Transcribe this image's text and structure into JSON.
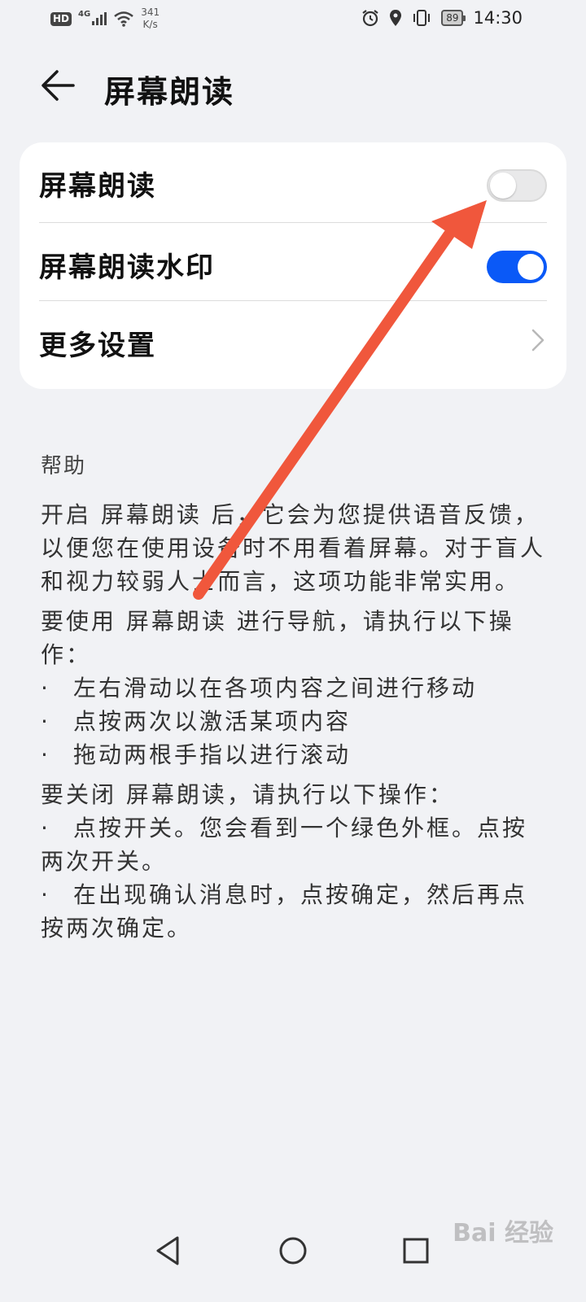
{
  "status_bar": {
    "hd": "HD",
    "network": "4G",
    "speed_value": "341",
    "speed_unit": "K/s",
    "battery": "89",
    "time": "14:30"
  },
  "header": {
    "title": "屏幕朗读"
  },
  "settings": {
    "items": [
      {
        "label": "屏幕朗读",
        "toggle": "off"
      },
      {
        "label": "屏幕朗读水印",
        "toggle": "on"
      },
      {
        "label": "更多设置"
      }
    ],
    "accent_color": "#0a59f7"
  },
  "help": {
    "title": "帮助",
    "paragraph1": "开启 屏幕朗读 后，它会为您提供语音反馈，以便您在使用设备时不用看着屏幕。对于盲人和视力较弱人士而言，这项功能非常实用。",
    "paragraph2": "要使用 屏幕朗读 进行导航，请执行以下操作：",
    "nav_bullets": [
      "左右滑动以在各项内容之间进行移动",
      "点按两次以激活某项内容",
      "拖动两根手指以进行滚动"
    ],
    "paragraph3": "要关闭 屏幕朗读，请执行以下操作：",
    "close_bullets": [
      "点按开关。您会看到一个绿色外框。点按两次开关。",
      "在出现确认消息时，点按确定，然后再点按两次确定。"
    ],
    "bullet_char": "·"
  },
  "annotation": {
    "arrow_color": "#f0573c"
  },
  "watermark": "Bai 经验"
}
